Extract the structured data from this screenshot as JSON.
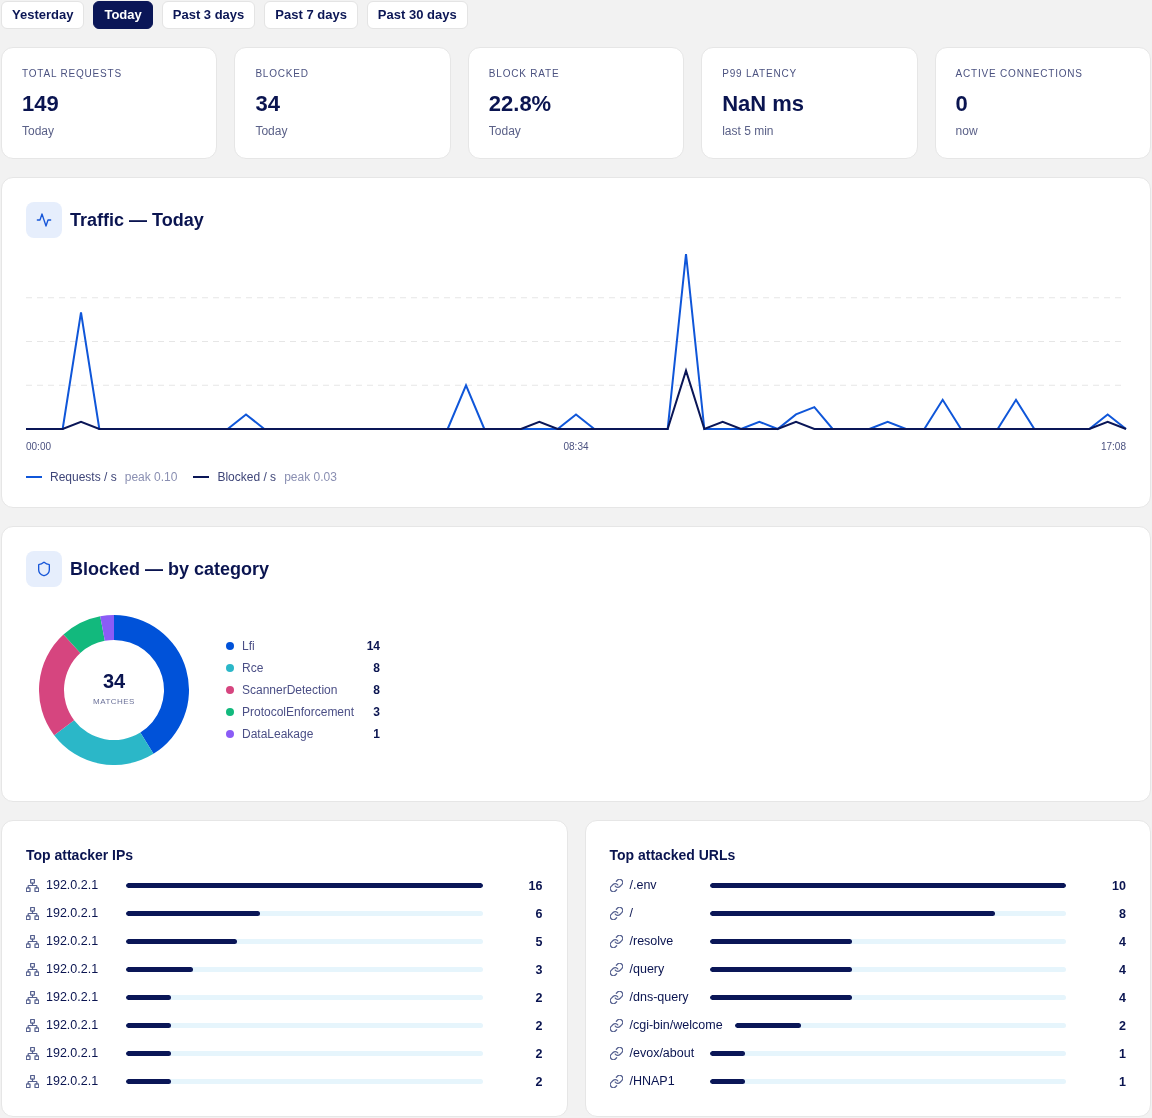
{
  "range_tabs": [
    {
      "label": "Yesterday",
      "selected": false
    },
    {
      "label": "Today",
      "selected": true
    },
    {
      "label": "Past 3 days",
      "selected": false
    },
    {
      "label": "Past 7 days",
      "selected": false
    },
    {
      "label": "Past 30 days",
      "selected": false
    }
  ],
  "stat_cards": [
    {
      "label": "TOTAL REQUESTS",
      "value": "149",
      "caption": "Today"
    },
    {
      "label": "BLOCKED",
      "value": "34",
      "caption": "Today"
    },
    {
      "label": "BLOCK RATE",
      "value": "22.8%",
      "caption": "Today"
    },
    {
      "label": "P99 LATENCY",
      "value": "NaN ms",
      "caption": "last 5 min"
    },
    {
      "label": "ACTIVE CONNECTIONS",
      "value": "0",
      "caption": "now"
    }
  ],
  "traffic_panel": {
    "title": "Traffic — Today",
    "x_labels": [
      "00:00",
      "08:34",
      "17:08"
    ],
    "legend": [
      {
        "label": "Requests / s",
        "peak": "peak 0.10",
        "color": "#0f56d9"
      },
      {
        "label": "Blocked / s",
        "peak": "peak 0.03",
        "color": "#0a1657"
      }
    ]
  },
  "category_panel": {
    "title": "Blocked — by category",
    "center_value": "34",
    "center_label": "MATCHES",
    "chart_data": {
      "type": "donut",
      "categories": [
        "Lfi",
        "Rce",
        "ScannerDetection",
        "ProtocolEnforcement",
        "DataLeakage"
      ],
      "values": [
        14,
        8,
        8,
        3,
        1
      ],
      "value_labels": [
        "14",
        "8",
        "8",
        "3",
        "1"
      ],
      "legend": "right"
    },
    "slices": [
      {
        "color": "#0052d9"
      },
      {
        "color": "#2bb7c8"
      },
      {
        "color": "#d6457f"
      },
      {
        "color": "#12b97d"
      },
      {
        "color": "#8b5cf6"
      }
    ]
  },
  "top_ips": {
    "title": "Top attacker IPs",
    "rows": [
      {
        "label": "192.0.2.1",
        "count": "16",
        "level": 1
      },
      {
        "label": "192.0.2.1",
        "count": "6",
        "level": 0.375
      },
      {
        "label": "192.0.2.1",
        "count": "5",
        "level": 0.3125
      },
      {
        "label": "192.0.2.1",
        "count": "3",
        "level": 0.1875
      },
      {
        "label": "192.0.2.1",
        "count": "2",
        "level": 0.125
      },
      {
        "label": "192.0.2.1",
        "count": "2",
        "level": 0.125
      },
      {
        "label": "192.0.2.1",
        "count": "2",
        "level": 0.125
      },
      {
        "label": "192.0.2.1",
        "count": "2",
        "level": 0.125
      }
    ]
  },
  "top_urls": {
    "title": "Top attacked URLs",
    "rows": [
      {
        "label": "/.env",
        "count": "10",
        "level": 1
      },
      {
        "label": "/",
        "count": "8",
        "level": 0.8
      },
      {
        "label": "/resolve",
        "count": "4",
        "level": 0.4
      },
      {
        "label": "/query",
        "count": "4",
        "level": 0.4
      },
      {
        "label": "/dns-query",
        "count": "4",
        "level": 0.4
      },
      {
        "label": "/cgi-bin/welcome",
        "count": "2",
        "level": 0.2
      },
      {
        "label": "/evox/about",
        "count": "1",
        "level": 0.1
      },
      {
        "label": "/HNAP1",
        "count": "1",
        "level": 0.1
      }
    ]
  }
}
